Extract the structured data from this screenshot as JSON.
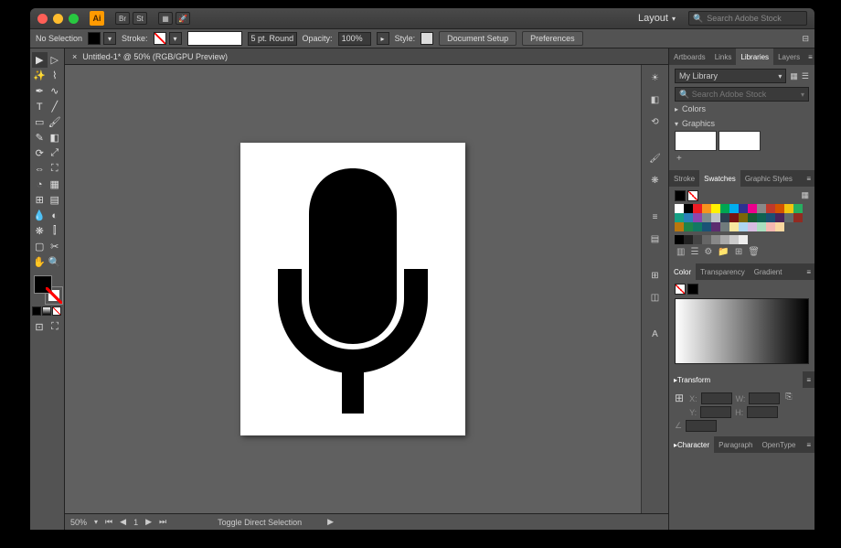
{
  "titlebar": {
    "ai": "Ai",
    "br": "Br",
    "st": "St"
  },
  "layout": {
    "label": "Layout"
  },
  "search": {
    "placeholder": "Search Adobe Stock"
  },
  "optbar": {
    "selection": "No Selection",
    "fill": "Fill:",
    "stroke": "Stroke:",
    "weight": "5 pt. Round",
    "opacity_label": "Opacity:",
    "opacity_val": "100%",
    "style": "Style:",
    "doc_setup": "Document Setup",
    "prefs": "Preferences"
  },
  "doc": {
    "tab": "Untitled-1* @ 50% (RGB/GPU Preview)",
    "close": "×"
  },
  "status": {
    "zoom": "50%",
    "page": "1",
    "tool": "Toggle Direct Selection"
  },
  "panels": {
    "libs": {
      "tabs": [
        "Artboards",
        "Links",
        "Libraries",
        "Layers"
      ],
      "my_library": "My Library",
      "search_ph": "Search Adobe Stock",
      "colors": "Colors",
      "graphics": "Graphics"
    },
    "swatches": {
      "tabs": [
        "Stroke",
        "Swatches",
        "Graphic Styles"
      ]
    },
    "color": {
      "tabs": [
        "Color",
        "Transparency",
        "Gradient"
      ]
    },
    "transform": {
      "title": "Transform",
      "x": "X:",
      "y": "Y:",
      "w": "W:",
      "h": "H:",
      "angle": "∠"
    },
    "type": {
      "tabs": [
        "Character",
        "Paragraph",
        "OpenType"
      ]
    }
  },
  "swatch_colors": [
    "#ffffff",
    "#000000",
    "#ed1c24",
    "#f7941d",
    "#fff200",
    "#00a651",
    "#00aeef",
    "#2e3192",
    "#ec008c",
    "#898989",
    "#c0392b",
    "#d35400",
    "#f1c40f",
    "#27ae60",
    "#16a085",
    "#2980b9",
    "#8e44ad",
    "#7f8c8d",
    "#bdc3c7",
    "#2c3e50",
    "#7a1313",
    "#7d6608",
    "#145a32",
    "#0e6251",
    "#1b4f72",
    "#4a235a",
    "#616a6b",
    "#922b21",
    "#b9770e",
    "#1e8449",
    "#117864",
    "#1a5276",
    "#5b2c6f",
    "#707b7c",
    "#f9e79f",
    "#aed6f1",
    "#d7bde2",
    "#a9dfbf",
    "#f5b7b1",
    "#fad7a0"
  ],
  "gray_ramp": [
    "#000000",
    "#222222",
    "#444444",
    "#666666",
    "#888888",
    "#aaaaaa",
    "#cccccc",
    "#eeeeee"
  ]
}
